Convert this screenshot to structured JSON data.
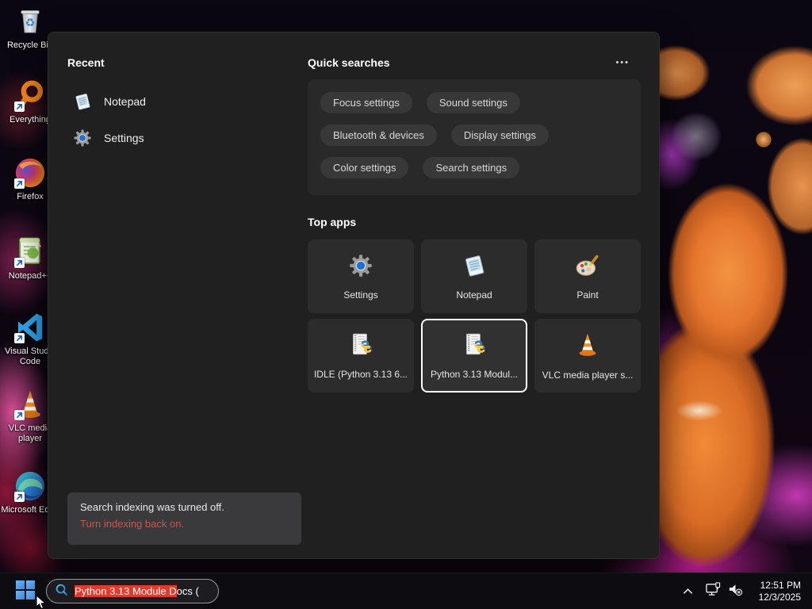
{
  "desktop": {
    "icons": [
      {
        "label": "Recycle Bin"
      },
      {
        "label": "Everything"
      },
      {
        "label": "Firefox"
      },
      {
        "label": "Notepad++"
      },
      {
        "label": "Visual Studio Code"
      },
      {
        "label": "VLC media player"
      },
      {
        "label": "Microsoft Edge"
      }
    ]
  },
  "search_panel": {
    "recent": {
      "heading": "Recent",
      "items": [
        {
          "label": "Notepad",
          "icon": "notepad-icon"
        },
        {
          "label": "Settings",
          "icon": "gear-icon"
        }
      ]
    },
    "quick_searches": {
      "heading": "Quick searches",
      "more_label": "•••",
      "pills": [
        "Focus settings",
        "Sound settings",
        "Bluetooth & devices",
        "Display settings",
        "Color settings",
        "Search settings"
      ]
    },
    "top_apps": {
      "heading": "Top apps",
      "tiles": [
        {
          "label": "Settings",
          "icon": "gear-icon",
          "selected": false
        },
        {
          "label": "Notepad",
          "icon": "notepad-icon",
          "selected": false
        },
        {
          "label": "Paint",
          "icon": "paint-palette-icon",
          "selected": false
        },
        {
          "label": "IDLE (Python 3.13 6...",
          "icon": "python-doc-icon",
          "selected": false
        },
        {
          "label": "Python 3.13 Modul...",
          "icon": "python-doc-icon",
          "selected": true
        },
        {
          "label": "VLC media player s...",
          "icon": "vlc-cone-icon",
          "selected": false
        }
      ]
    },
    "indexing_notice": {
      "message": "Search indexing was turned off.",
      "action": "Turn indexing back on."
    }
  },
  "taskbar": {
    "search": {
      "highlighted_text": "Python 3.13 Module D",
      "rest_text": "ocs (",
      "icon": "search-icon"
    },
    "tray": {
      "icons": [
        "chevron-up-icon",
        "network-ethernet-icon",
        "volume-muted-icon"
      ],
      "time": "12:51 PM",
      "date": "12/3/2025"
    }
  },
  "colors": {
    "selection_highlight": "#e23b2e",
    "notice_link": "#c4574e",
    "panel_bg": "#202020",
    "tile_selected_border": "#ffffff"
  }
}
